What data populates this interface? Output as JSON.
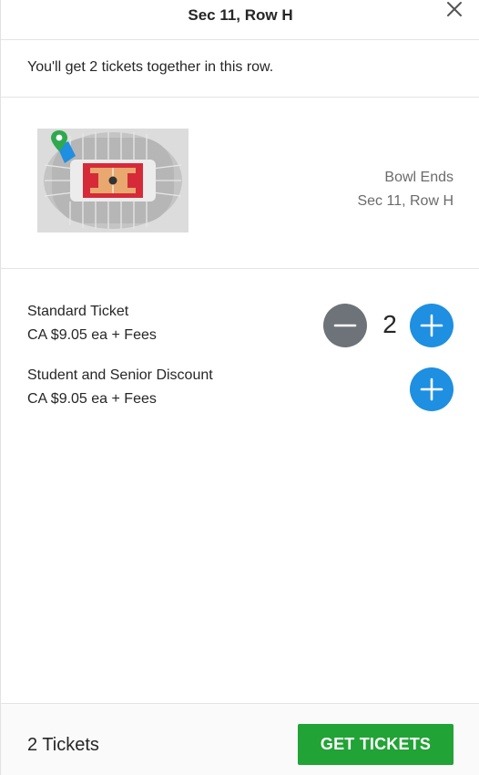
{
  "header": {
    "title": "Sec 11, Row H",
    "close_icon": "close-icon"
  },
  "notice": {
    "text": "You'll get 2 tickets together in this row."
  },
  "seat": {
    "area": "Bowl Ends",
    "location": "Sec 11, Row H",
    "map_icon": "venue-map-icon"
  },
  "tickets": [
    {
      "name": "Standard Ticket",
      "price": "CA $9.05 ea + Fees",
      "quantity": "2",
      "has_minus": true
    },
    {
      "name": "Student and Senior Discount",
      "price": "CA $9.05 ea + Fees",
      "quantity": "",
      "has_minus": false
    }
  ],
  "footer": {
    "count_label": "2 Tickets",
    "cta_label": "GET TICKETS"
  },
  "colors": {
    "primary_blue": "#1e8fe1",
    "minus_gray": "#6d7379",
    "cta_green": "#21a336",
    "court_red": "#d62a39",
    "pin_green": "#2fa84f"
  }
}
